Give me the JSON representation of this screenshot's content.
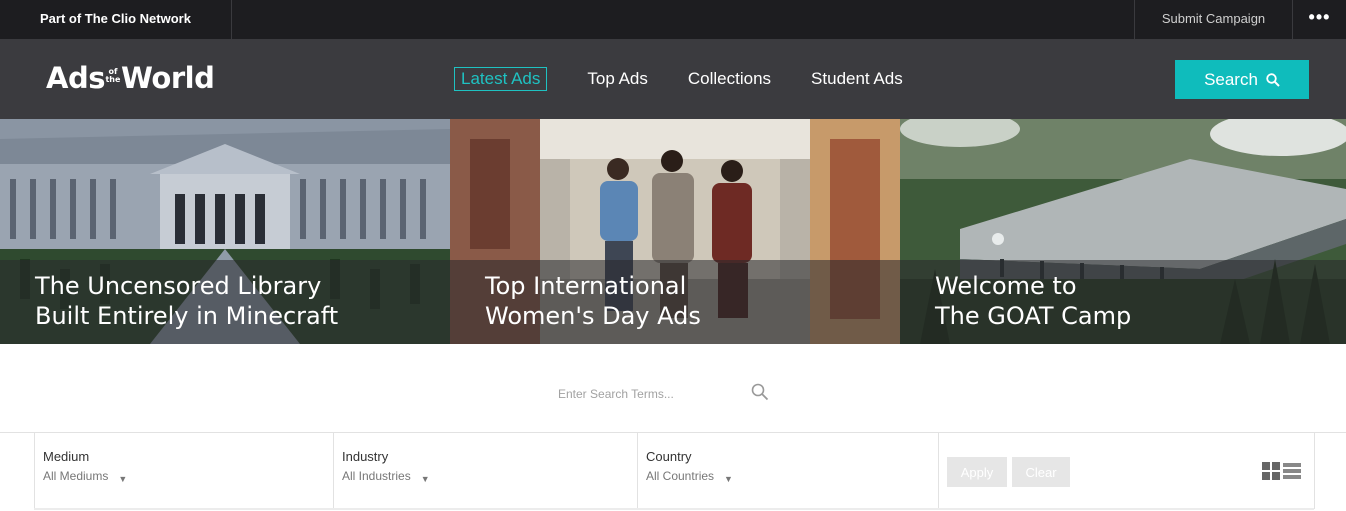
{
  "topbar": {
    "network_label": "Part of The Clio Network",
    "submit_label": "Submit Campaign",
    "more_label": "•••"
  },
  "nav": {
    "logo": {
      "left": "Ads",
      "small_top": "of",
      "small_bottom": "the",
      "right": "World"
    },
    "links": [
      "Latest Ads",
      "Top Ads",
      "Collections",
      "Student Ads"
    ],
    "active_link": "Latest Ads",
    "search_label": "Search"
  },
  "hero": {
    "tiles": [
      {
        "line1": "The Uncensored Library",
        "line2": "Built Entirely in Minecraft"
      },
      {
        "line1": "Top International",
        "line2": "Women's Day Ads"
      },
      {
        "line1": "Welcome to",
        "line2": "The GOAT Camp"
      }
    ]
  },
  "search": {
    "placeholder": "Enter Search Terms..."
  },
  "filters": {
    "medium": {
      "label": "Medium",
      "value": "All Mediums"
    },
    "industry": {
      "label": "Industry",
      "value": "All Industries"
    },
    "country": {
      "label": "Country",
      "value": "All Countries"
    },
    "apply_label": "Apply",
    "clear_label": "Clear"
  },
  "colors": {
    "accent": "#0fbcbc",
    "topbar": "#1d1d20",
    "nav": "#3b3b3f"
  }
}
